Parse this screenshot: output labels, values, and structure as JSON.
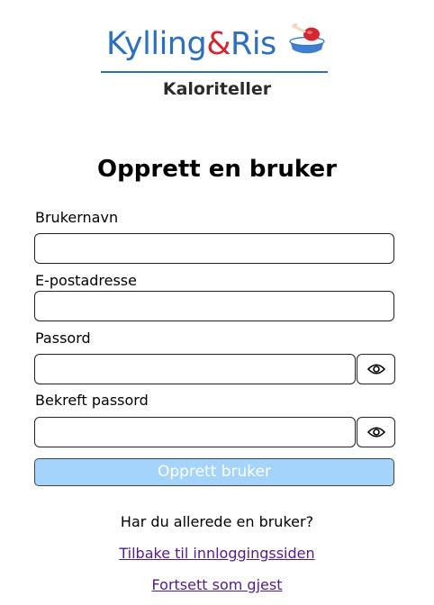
{
  "logo": {
    "part_a": "Kylling",
    "part_b": "&",
    "part_c": "Ris",
    "icon": "chicken-rice-bowl-icon",
    "colors": {
      "blue": "#2a6fc0",
      "red": "#d6262f"
    }
  },
  "subtitle": "Kaloriteller",
  "form": {
    "title": "Opprett en bruker",
    "fields": {
      "username": {
        "label": "Brukernavn",
        "value": "",
        "placeholder": ""
      },
      "email": {
        "label": "E-postadresse",
        "value": "",
        "placeholder": ""
      },
      "password": {
        "label": "Passord",
        "value": "",
        "placeholder": "",
        "toggle_icon": "eye-icon"
      },
      "confirm_password": {
        "label": "Bekreft passord",
        "value": "",
        "placeholder": "",
        "toggle_icon": "eye-icon"
      }
    },
    "submit_label": "Opprett bruker",
    "submit_color": "#a4d3fb"
  },
  "footer": {
    "question": "Har du allerede en bruker?",
    "login_link": "Tilbake til innloggingssiden",
    "guest_link": "Fortsett som gjest",
    "link_color": "#551a8b"
  }
}
